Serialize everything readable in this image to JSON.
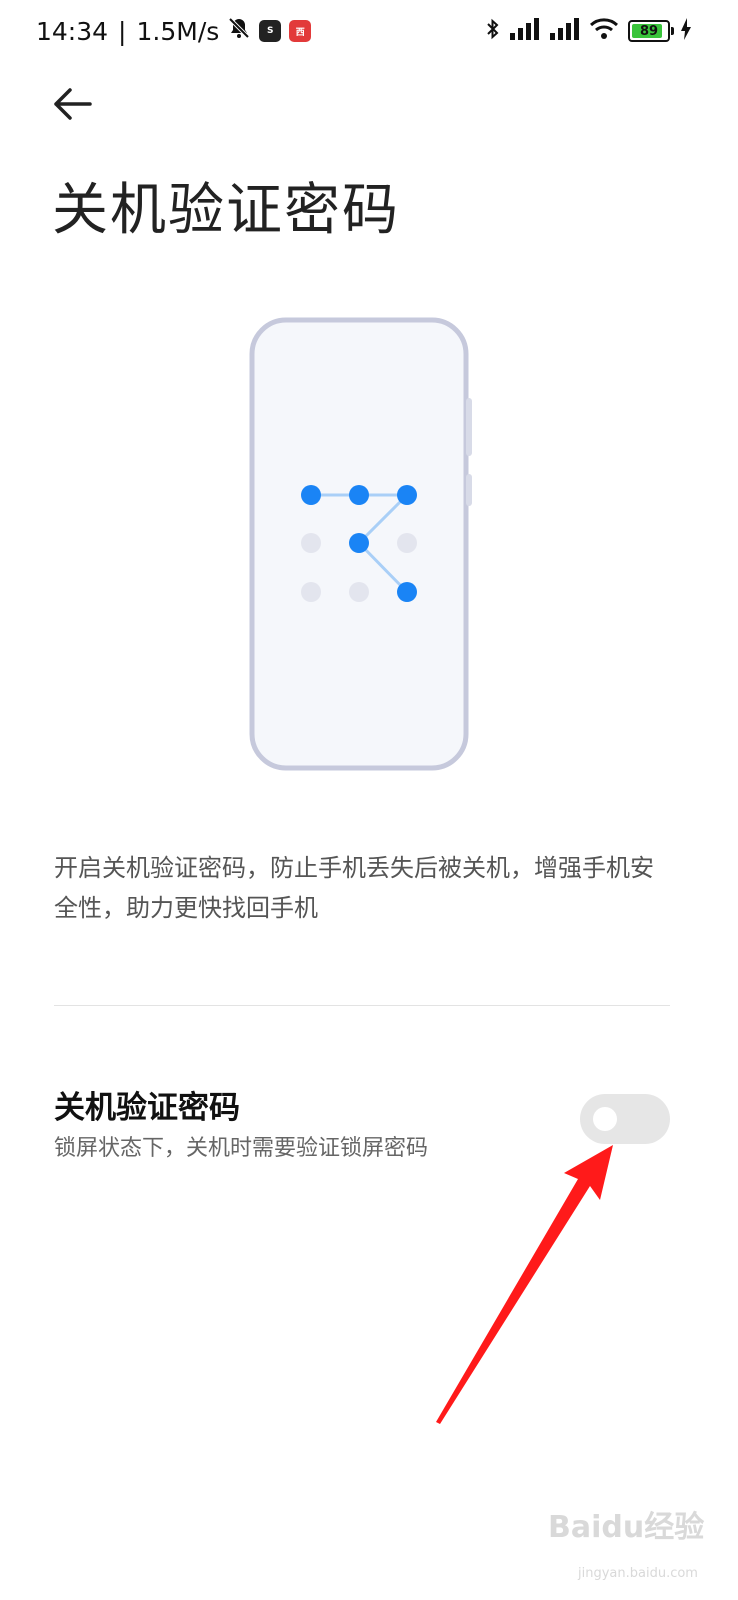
{
  "status_bar": {
    "time": "14:34",
    "separator": "|",
    "speed": "1.5M/s",
    "battery": "89",
    "battery_level": 0.89,
    "icons": [
      "mute-icon",
      "soul-app-icon",
      "red-app-icon",
      "bluetooth-icon",
      "signal-icon",
      "signal-icon",
      "wifi-icon",
      "battery-icon",
      "charging-icon"
    ]
  },
  "header": {
    "back_icon": "arrow-left-icon",
    "title": "关机验证密码"
  },
  "illustration": {
    "name": "pattern-lock-phone",
    "accent": "#1a84f5",
    "frame": "#c6c9dc"
  },
  "description": "开启关机验证密码，防止手机丢失后被关机，增强手机安全性，助力更快找回手机",
  "setting": {
    "title": "关机验证密码",
    "subtitle": "锁屏状态下，关机时需要验证锁屏密码",
    "enabled": false
  },
  "annotation": {
    "color": "#ff1a1a"
  },
  "watermark": {
    "main": "Baidu经验",
    "sub": "jingyan.baidu.com"
  }
}
